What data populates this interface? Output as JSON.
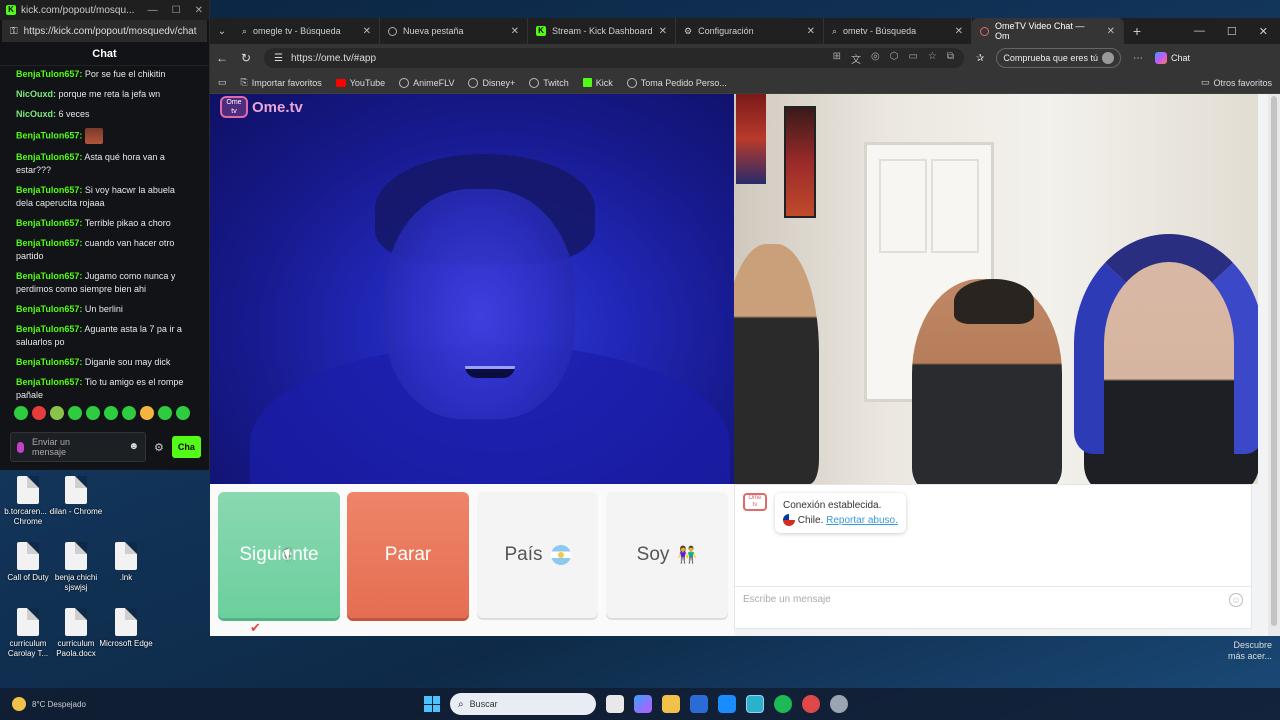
{
  "kick_window": {
    "title": "kick.com/popout/mosqu...",
    "url": "https://kick.com/popout/mosquedv/chat",
    "chat_header": "Chat",
    "messages": [
      {
        "user": "BenjaTulon657:",
        "text": "Por se fue el chikitin",
        "emote": false
      },
      {
        "user": "NicOuxd:",
        "text": "porque me reta la jefa wn",
        "emote": false
      },
      {
        "user": "NicOuxd:",
        "text": "6 veces",
        "emote": false
      },
      {
        "user": "BenjaTulon657:",
        "text": "",
        "emote": true
      },
      {
        "user": "BenjaTulon657:",
        "text": "Asta qué hora van a estar???",
        "emote": false
      },
      {
        "user": "BenjaTulon657:",
        "text": "Si voy hacwr la abuela dela caperucita rojaaa",
        "emote": false
      },
      {
        "user": "BenjaTulon657:",
        "text": "Terrible pikao a choro",
        "emote": false
      },
      {
        "user": "BenjaTulon657:",
        "text": "cuando van hacer otro partido",
        "emote": false
      },
      {
        "user": "BenjaTulon657:",
        "text": "Jugamo como nunca y perdimos como siempre bien ahi",
        "emote": false
      },
      {
        "user": "BenjaTulon657:",
        "text": "Un berlini",
        "emote": false
      },
      {
        "user": "BenjaTulon657:",
        "text": "Aguante asta la 7 pa ir a saluarlos po",
        "emote": false
      },
      {
        "user": "BenjaTulon657:",
        "text": "Diganle sou may dick",
        "emote": false
      },
      {
        "user": "BenjaTulon657:",
        "text": "Tio tu amigo es el rompe pañale",
        "emote": false
      },
      {
        "user": "BenjaTulon657:",
        "text": "",
        "emote": true
      }
    ],
    "input_placeholder": "Enviar un mensaje",
    "chat_button": "Cha"
  },
  "browser": {
    "tabs": [
      {
        "label": "omegle tv - Búsqueda",
        "icon": "search-icon",
        "active": false
      },
      {
        "label": "Nueva pestaña",
        "icon": "page-icon",
        "active": false
      },
      {
        "label": "Stream - Kick Dashboard",
        "icon": "kick-icon",
        "active": false
      },
      {
        "label": "Configuración",
        "icon": "gear-icon",
        "active": false
      },
      {
        "label": "ometv - Búsqueda",
        "icon": "search-icon",
        "active": false
      },
      {
        "label": "OmeTV Video Chat — Om",
        "icon": "ometv-icon",
        "active": true
      }
    ],
    "url": "https://ome.tv/#app",
    "profile_button": "Comprueba que eres tú",
    "copilot_label": "Chat",
    "bookmarks": [
      {
        "label": "Importar favoritos",
        "icon": "import-icon"
      },
      {
        "label": "YouTube",
        "icon": "youtube-icon"
      },
      {
        "label": "AnimeFLV",
        "icon": "globe-icon"
      },
      {
        "label": "Disney+",
        "icon": "globe-icon"
      },
      {
        "label": "Twitch",
        "icon": "globe-icon"
      },
      {
        "label": "Kick",
        "icon": "kick-icon"
      },
      {
        "label": "Toma Pedido Perso...",
        "icon": "globe-icon"
      }
    ],
    "other_favorites": "Otros favoritos"
  },
  "ometv": {
    "logo_text": "Ome.tv",
    "buttons": {
      "next": "Siguiente",
      "stop": "Parar",
      "country": "País",
      "me": "Soy"
    },
    "system_message": {
      "status": "Conexión establecida.",
      "country": "Chile.",
      "report_link": "Reportar abuso."
    },
    "message_placeholder": "Escribe un mensaje"
  },
  "desktop": {
    "icons": [
      {
        "label": "b.torcaren... - Chrome"
      },
      {
        "label": "dilan - Chrome"
      },
      {
        "label": "Call of Duty"
      },
      {
        "label": "benja chichi sjswjsj"
      },
      {
        "label": ".lnk"
      },
      {
        "label": "curriculum Carolay T..."
      },
      {
        "label": "curriculum Paola.docx"
      },
      {
        "label": "Microsoft Edge"
      }
    ],
    "corner_label": "Descubre más acer..."
  },
  "taskbar": {
    "search_placeholder": "Buscar",
    "weather": "8°C Despejado"
  }
}
